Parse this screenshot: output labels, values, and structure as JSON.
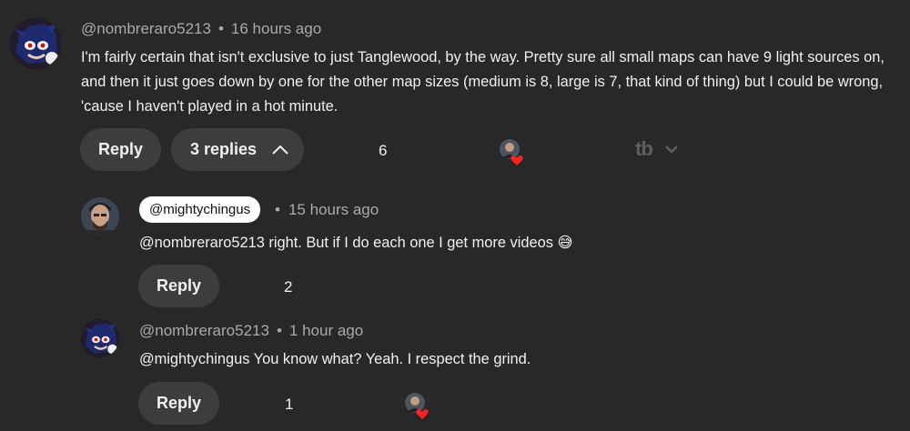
{
  "comment": {
    "author": "@nombreraro5213",
    "separator": "•",
    "time": "16 hours ago",
    "text": "I'm fairly certain that isn't exclusive to just Tanglewood, by the way. Pretty sure all small maps can have 9 light sources on, and then it just goes down by one for the other map sizes (medium is 8, large is 7, that kind of thing) but I could be wrong, 'cause I haven't played in a hot minute.",
    "reply_label": "Reply",
    "replies_label": "3 replies",
    "likes": "6",
    "tb_label": "tb"
  },
  "replies": [
    {
      "author": "@mightychingus",
      "separator": "•",
      "time": "15 hours ago",
      "text": "@nombreraro5213  right.  But if I do each one I get more videos 😅",
      "reply_label": "Reply",
      "likes": "2"
    },
    {
      "author": "@nombreraro5213",
      "separator": "•",
      "time": "1 hour ago",
      "text": "@mightychingus You know what? Yeah. I respect the grind.",
      "reply_label": "Reply",
      "likes": "1"
    }
  ],
  "icons": {
    "hearted": "creator-heart-icon",
    "expand": "chevron-up-icon",
    "tb_menu": "chevron-down-icon"
  },
  "colors": {
    "background": "#282828",
    "pill": "#3d3d3d",
    "heart": "#ff0000"
  }
}
